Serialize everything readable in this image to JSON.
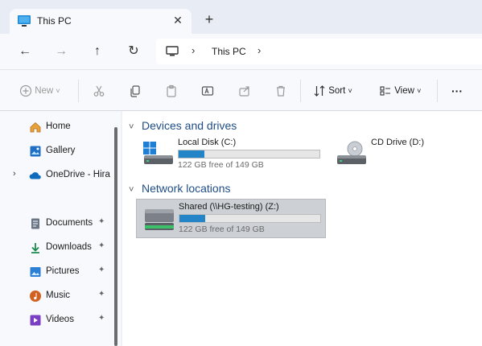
{
  "tab": {
    "title": "This PC",
    "close_glyph": "✕",
    "new_tab_glyph": "+"
  },
  "nav": {
    "back_glyph": "←",
    "forward_glyph": "→",
    "up_glyph": "↑",
    "refresh_glyph": "↻",
    "address_sep": "›",
    "address_location": "This PC"
  },
  "commands": {
    "new": "New",
    "sort": "Sort",
    "view": "View",
    "more_glyph": "···",
    "dropdown_glyph": "˅"
  },
  "sidebar": {
    "items": [
      {
        "label": "Home",
        "icon": "home-icon",
        "pinned": false
      },
      {
        "label": "Gallery",
        "icon": "gallery-icon",
        "pinned": false
      },
      {
        "label": "OneDrive - Hirai",
        "icon": "onedrive-icon",
        "pinned": false,
        "expandable": true
      },
      {
        "label": "Documents",
        "icon": "documents-icon",
        "pinned": true
      },
      {
        "label": "Downloads",
        "icon": "downloads-icon",
        "pinned": true
      },
      {
        "label": "Pictures",
        "icon": "pictures-icon",
        "pinned": true
      },
      {
        "label": "Music",
        "icon": "music-icon",
        "pinned": true
      },
      {
        "label": "Videos",
        "icon": "videos-icon",
        "pinned": true
      }
    ],
    "pin_glyph": "📌",
    "chevron_glyph": "›"
  },
  "main": {
    "devices_heading": "Devices and drives",
    "network_heading": "Network locations",
    "group_chevron": "˅",
    "drives": [
      {
        "name": "Local Disk (C:)",
        "free_text": "122 GB free of 149 GB",
        "used_fraction": 0.18
      },
      {
        "name": "CD Drive (D:)"
      }
    ],
    "network": [
      {
        "name": "Shared (\\\\HG-testing) (Z:)",
        "free_text": "122 GB free of 149 GB",
        "used_fraction": 0.18
      }
    ]
  },
  "colors": {
    "accent": "#2384c8",
    "heading": "#1f4d86",
    "selection": "#cdd0d5"
  }
}
